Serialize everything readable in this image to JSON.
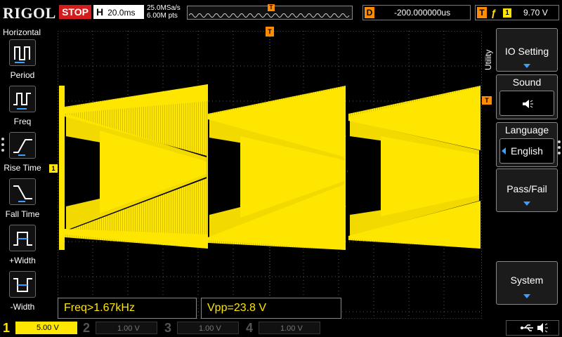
{
  "header": {
    "logo": "RIGOL",
    "run_status": "STOP",
    "horizontal_label": "H",
    "timebase": "20.0ms",
    "sample_rate": "25.0MSa/s",
    "memory_depth": "6.00M pts",
    "trigger_marker": "T",
    "delay_label": "D",
    "delay_value": "-200.000000us",
    "trigger_label": "T",
    "trigger_edge": "ƒ",
    "trigger_source": "1",
    "trigger_level": "9.70 V"
  },
  "left_menu": {
    "title": "Horizontal",
    "items": [
      {
        "label": "Period",
        "icon": "period-icon"
      },
      {
        "label": "Freq",
        "icon": "frequency-icon"
      },
      {
        "label": "Rise Time",
        "icon": "rise-time-icon"
      },
      {
        "label": "Fall Time",
        "icon": "fall-time-icon"
      },
      {
        "label": "+Width",
        "icon": "positive-width-icon"
      },
      {
        "label": "-Width",
        "icon": "negative-width-icon"
      }
    ]
  },
  "screen": {
    "ch1_marker": "1",
    "trigger_level_marker": "T",
    "trigger_position_marker": "T"
  },
  "measurements": [
    {
      "text": "Freq>1.67kHz"
    },
    {
      "text": "Vpp=23.8 V"
    }
  ],
  "right_menu": {
    "tab": "Utility",
    "buttons": [
      {
        "label": "IO Setting"
      },
      {
        "label": "Sound",
        "icon": "speaker-icon"
      },
      {
        "label": "Language",
        "value": "English"
      },
      {
        "label": "Pass/Fail"
      },
      {
        "label": "System"
      }
    ]
  },
  "channels": [
    {
      "num": "1",
      "scale": "5.00 V",
      "color": "#ffe600",
      "active": true
    },
    {
      "num": "2",
      "scale": "1.00 V",
      "color": "#19e3e3",
      "active": false
    },
    {
      "num": "3",
      "scale": "1.00 V",
      "color": "#e03cff",
      "active": false
    },
    {
      "num": "4",
      "scale": "1.00 V",
      "color": "#3a7cff",
      "active": false
    }
  ],
  "colors": {
    "trace": "#ffe600",
    "trigger": "#ff8c00",
    "stop": "#d41c1c",
    "accent": "#3aa0ff"
  }
}
